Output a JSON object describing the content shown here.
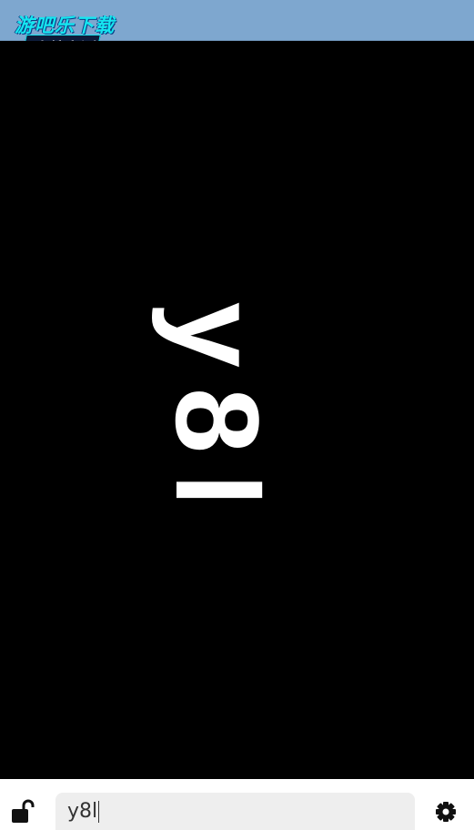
{
  "watermark": {
    "line1": "游吧乐下载",
    "line2": "小编亲测"
  },
  "display": {
    "text": "y8l",
    "rotation": "90deg clockwise"
  },
  "bottom_bar": {
    "lock_icon": "unlocked-padlock-icon",
    "input_value": "y8l",
    "settings_icon": "gear-icon"
  },
  "colors": {
    "top_bar": "#7ea7cf",
    "display_bg": "#000000",
    "display_text": "#ffffff",
    "input_bg": "#eeeeee"
  }
}
